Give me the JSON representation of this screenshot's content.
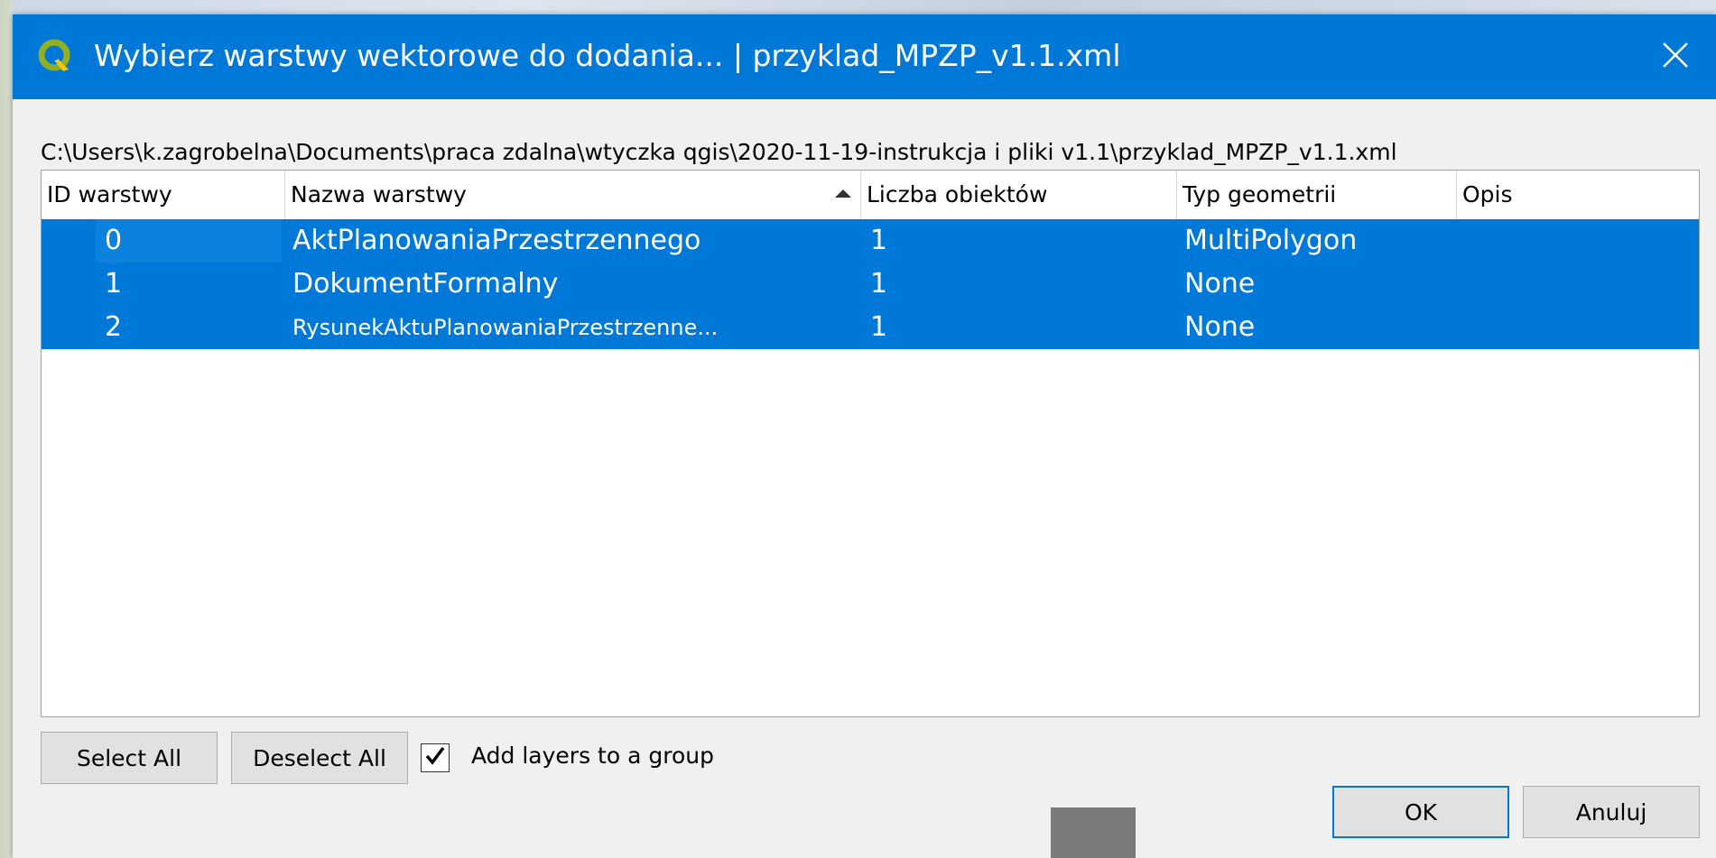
{
  "dialog": {
    "title": "Wybierz warstwy wektorowe do dodania... | przyklad_MPZP_v1.1.xml",
    "file_path": "C:\\Users\\k.zagrobelna\\Documents\\praca zdalna\\wtyczka qgis\\2020-11-19-instrukcja i pliki v1.1\\przyklad_MPZP_v1.1.xml"
  },
  "table": {
    "columns": [
      "ID warstwy",
      "Nazwa warstwy",
      "Liczba obiektów",
      "Typ geometrii",
      "Opis"
    ],
    "sorted_column": "Nazwa warstwy",
    "sort_direction": "ascending",
    "rows": [
      {
        "id": "0",
        "name": "AktPlanowaniaPrzestrzennego",
        "count": "1",
        "geometry": "MultiPolygon",
        "description": "",
        "selected": true
      },
      {
        "id": "1",
        "name": "DokumentFormalny",
        "count": "1",
        "geometry": "None",
        "description": "",
        "selected": true
      },
      {
        "id": "2",
        "name": "RysunekAktuPlanowaniaPrzestrzenne...",
        "count": "1",
        "geometry": "None",
        "description": "",
        "selected": true
      }
    ]
  },
  "buttons": {
    "select_all": "Select All",
    "deselect_all": "Deselect All",
    "ok": "OK",
    "cancel": "Anuluj"
  },
  "group_option": {
    "label": "Add layers to a group",
    "checked": true
  },
  "colors": {
    "accent": "#0078d7",
    "title_text": "#ffffff",
    "qgis_green": "#93b023",
    "qgis_yellow": "#f0c619"
  },
  "icons": {
    "title_icon": "qgis-logo-icon",
    "close_icon": "close-icon",
    "check_icon": "checkmark-icon",
    "sort_icon": "sort-ascending-icon"
  }
}
